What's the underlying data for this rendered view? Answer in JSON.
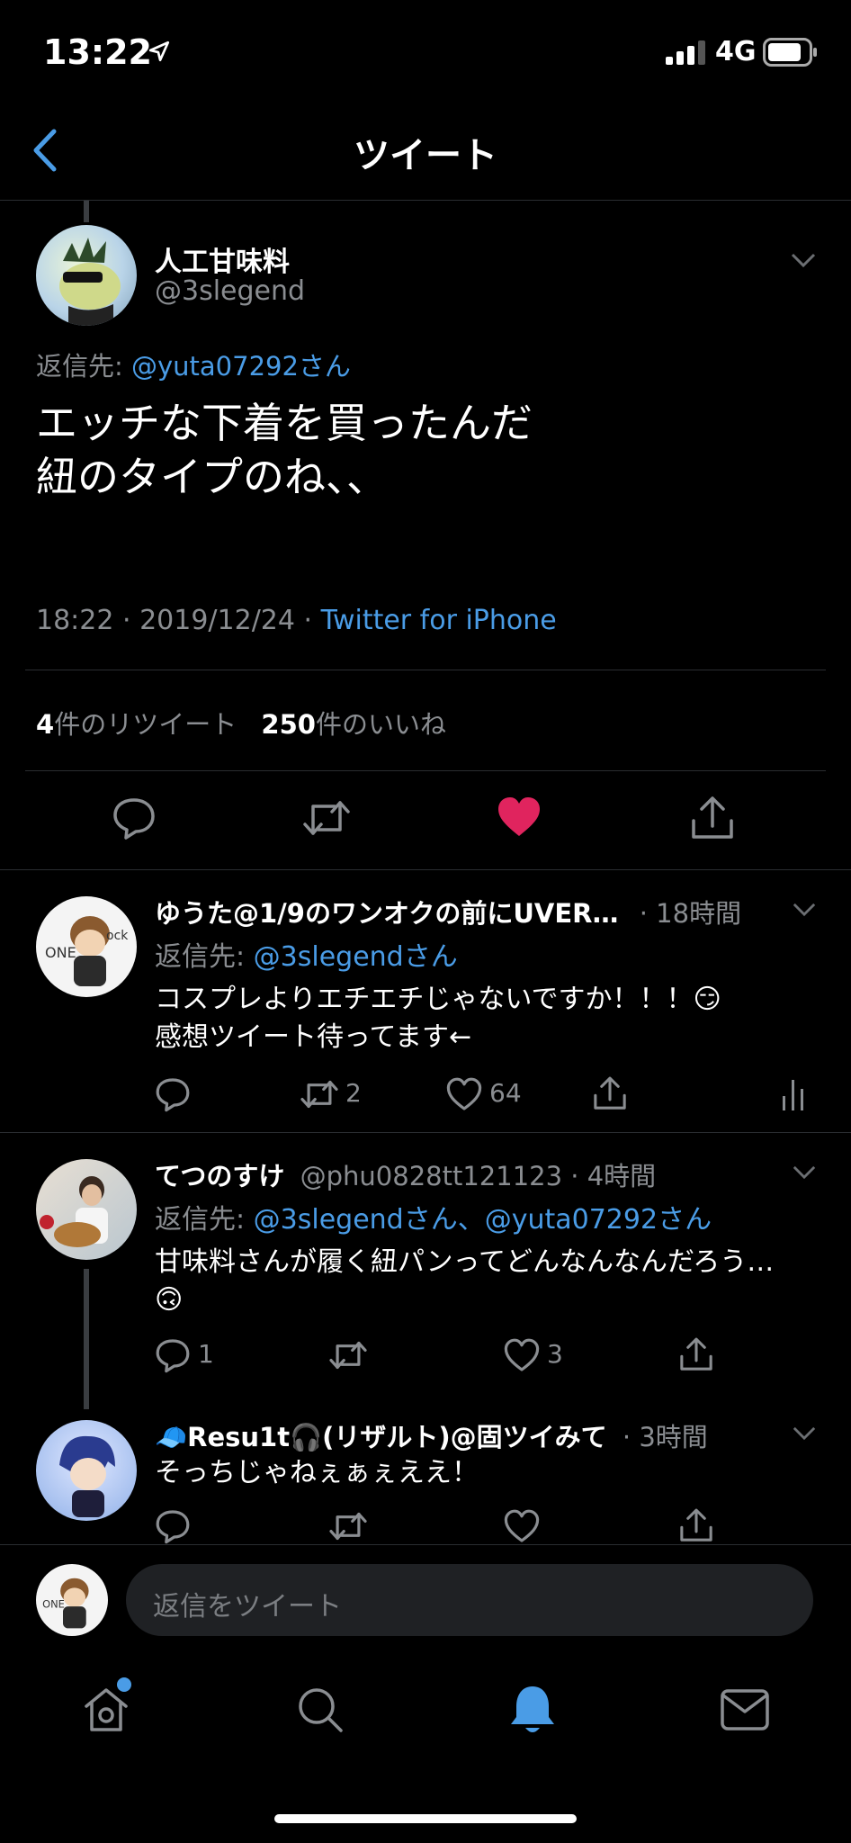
{
  "status_bar": {
    "time": "13:22",
    "network": "4G"
  },
  "header": {
    "title": "ツイート"
  },
  "main_tweet": {
    "display_name": "人工甘味料",
    "handle": "@3slegend",
    "reply_prefix": "返信先:",
    "reply_to": "@yuta07292さん",
    "text_line1": "エッチな下着を買ったんだ",
    "text_line2": "紐のタイプのね、、",
    "timestamp": "18:22 · 2019/12/24 ·",
    "source": "Twitter for iPhone",
    "retweet_count": "4",
    "retweet_label": "件のリツイート",
    "like_count": "250",
    "like_label": "件のいいね"
  },
  "replies": [
    {
      "display_name": "ゆうた@1/9のワンオクの前にUVER…",
      "meta": "· 18時間",
      "reply_prefix": "返信先:",
      "reply_to": "@3slegendさん",
      "text_line1": "コスプレよりエチエチじゃないですか！！！😏",
      "text_line2": "感想ツイート待ってます←",
      "retweets": "2",
      "likes": "64"
    },
    {
      "display_name": "てつのすけ",
      "meta": "@phu0828tt121123 · 4時間",
      "reply_prefix": "返信先:",
      "reply_to": "@3slegendさん、@yuta07292さん",
      "text_line1": "甘味料さんが履く紐パンってどんなんなんだろう…",
      "text_line2": "🙃",
      "replies": "1",
      "likes": "3"
    },
    {
      "display_name": "🧢Resu1t🎧(リザルト)@固ツイみて",
      "meta": "· 3時間",
      "text_line1": "そっちじゃねぇぁぇええ！"
    }
  ],
  "compose": {
    "placeholder": "返信をツイート"
  },
  "tab_bar": {
    "items": [
      "home-icon",
      "search-icon",
      "bell-icon",
      "mail-icon"
    ],
    "active": "bell-icon",
    "active_color": "#4a9ce6"
  },
  "colors": {
    "accent": "#4a9ce6",
    "like": "#e0245e",
    "background": "#000000"
  }
}
